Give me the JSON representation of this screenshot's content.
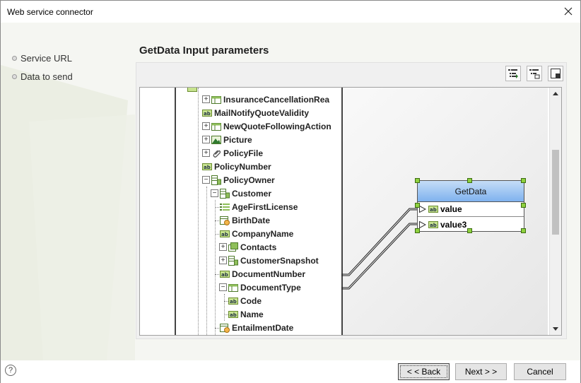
{
  "window": {
    "title": "Web service connector"
  },
  "steps": [
    {
      "label": "Service URL"
    },
    {
      "label": "Data to send"
    }
  ],
  "page_title": "GetData Input parameters",
  "toolbar": {
    "buttons": [
      {
        "icon": "expand-tree-icon"
      },
      {
        "icon": "collapse-tree-icon"
      },
      {
        "icon": "layout-icon"
      }
    ]
  },
  "tree": {
    "items": [
      {
        "label": "InsuranceCancellationRea",
        "icon": "table-icon",
        "expander": "+"
      },
      {
        "label": "MailNotifyQuoteValidity",
        "icon": "text-field-icon",
        "expander": ""
      },
      {
        "label": "NewQuoteFollowingAction",
        "icon": "table-icon",
        "expander": "+"
      },
      {
        "label": "Picture",
        "icon": "image-icon",
        "expander": "+"
      },
      {
        "label": "PolicyFile",
        "icon": "attachment-icon",
        "expander": "+"
      },
      {
        "label": "PolicyNumber",
        "icon": "text-field-icon",
        "expander": ""
      },
      {
        "label": "PolicyOwner",
        "icon": "entity-icon",
        "expander": "−"
      },
      {
        "label": "Customer",
        "icon": "entity-icon",
        "expander": "−"
      },
      {
        "label": "AgeFirstLicense",
        "icon": "number-icon",
        "expander": ""
      },
      {
        "label": "BirthDate",
        "icon": "date-icon",
        "expander": ""
      },
      {
        "label": "CompanyName",
        "icon": "text-field-icon",
        "expander": ""
      },
      {
        "label": "Contacts",
        "icon": "collection-icon",
        "expander": "+"
      },
      {
        "label": "CustomerSnapshot",
        "icon": "entity-icon",
        "expander": "+"
      },
      {
        "label": "DocumentNumber",
        "icon": "text-field-icon",
        "expander": ""
      },
      {
        "label": "DocumentType",
        "icon": "table-icon",
        "expander": "−"
      },
      {
        "label": "Code",
        "icon": "text-field-icon",
        "expander": ""
      },
      {
        "label": "Name",
        "icon": "text-field-icon",
        "expander": ""
      },
      {
        "label": "EntailmentDate",
        "icon": "date-icon",
        "expander": ""
      }
    ]
  },
  "node": {
    "title": "GetData",
    "params": [
      {
        "label": "value",
        "icon": "text-field-icon"
      },
      {
        "label": "value3",
        "icon": "text-field-icon"
      }
    ]
  },
  "mappings": [
    {
      "from": "DocumentNumber",
      "to": "value"
    },
    {
      "from": "DocumentType",
      "to": "value3"
    }
  ],
  "footer": {
    "help_label": "?",
    "back_label": "< < Back",
    "next_label": "Next > >",
    "cancel_label": "Cancel"
  },
  "colors": {
    "node_header_top": "#c5ddf7",
    "node_header_bottom": "#7fb2ee",
    "handle": "#8fd13f"
  }
}
